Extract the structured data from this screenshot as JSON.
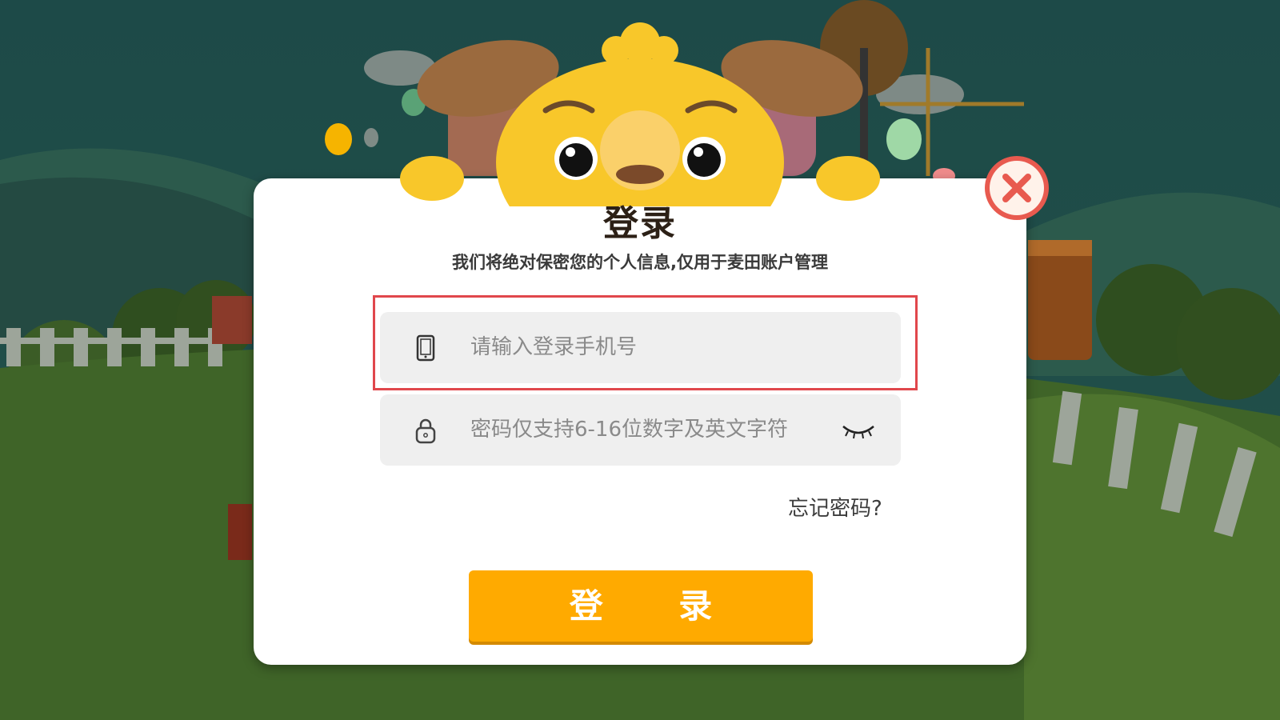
{
  "dialog": {
    "title": "登录",
    "subtitle": "我们将绝对保密您的个人信息,仅用于麦田账户管理"
  },
  "phone_field": {
    "placeholder": "请输入登录手机号",
    "icon": "phone-icon"
  },
  "password_field": {
    "placeholder": "密码仅支持6-16位数字及英文字符",
    "icon": "lock-icon",
    "toggle_icon": "eye-closed-icon"
  },
  "forgot_link": "忘记密码?",
  "login_button": "登 录",
  "close_icon": "close-icon",
  "colors": {
    "accent": "#ffaa00",
    "highlight_border": "#e0474c",
    "close_red": "#e85a4f"
  }
}
